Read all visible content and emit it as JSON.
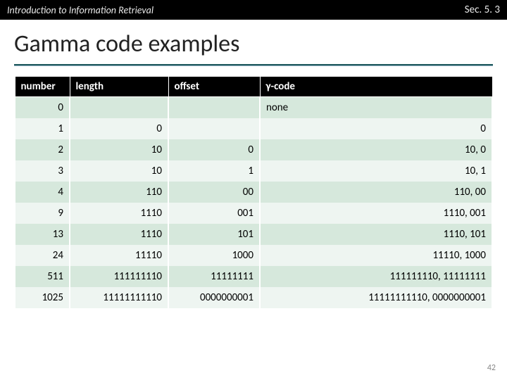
{
  "topbar": {
    "left": "Introduction to Information Retrieval",
    "right": "Sec. 5. 3"
  },
  "title": "Gamma code examples",
  "table": {
    "headers": [
      "number",
      "length",
      "offset",
      "γ-code"
    ],
    "rows": [
      {
        "number": "0",
        "length": "",
        "offset": "",
        "code": "none"
      },
      {
        "number": "1",
        "length": "0",
        "offset": "",
        "code": "0"
      },
      {
        "number": "2",
        "length": "10",
        "offset": "0",
        "code": "10, 0"
      },
      {
        "number": "3",
        "length": "10",
        "offset": "1",
        "code": "10, 1"
      },
      {
        "number": "4",
        "length": "110",
        "offset": "00",
        "code": "110, 00"
      },
      {
        "number": "9",
        "length": "1110",
        "offset": "001",
        "code": "1110, 001"
      },
      {
        "number": "13",
        "length": "1110",
        "offset": "101",
        "code": "1110, 101"
      },
      {
        "number": "24",
        "length": "11110",
        "offset": "1000",
        "code": "11110, 1000"
      },
      {
        "number": "511",
        "length": "111111110",
        "offset": "11111111",
        "code": "111111110, 11111111"
      },
      {
        "number": "1025",
        "length": "11111111110",
        "offset": "0000000001",
        "code": "11111111110, 0000000001"
      }
    ]
  },
  "pagenum": "42"
}
